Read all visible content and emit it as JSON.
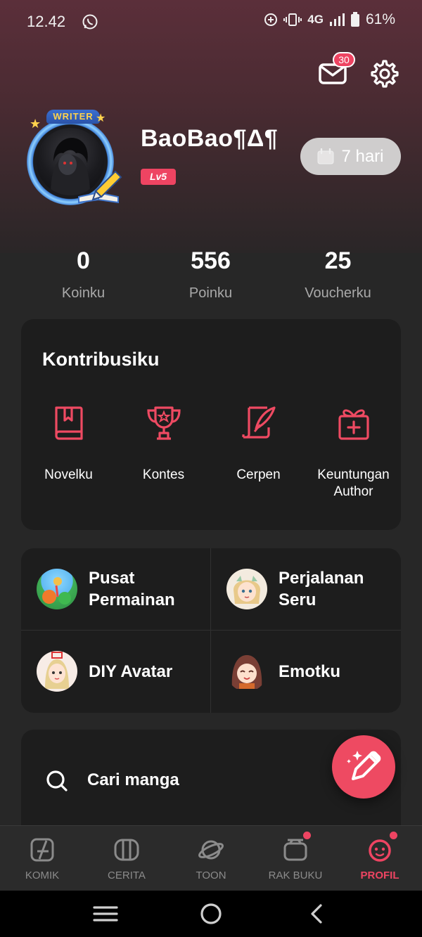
{
  "status_bar": {
    "time": "12.42",
    "network": "4G",
    "battery": "61%"
  },
  "header": {
    "mail_badge": "30"
  },
  "profile": {
    "writer_label": "WRITER",
    "username": "BaoBao¶Δ¶",
    "level": "Lv5",
    "checkin": "7 hari"
  },
  "stats": [
    {
      "value": "0",
      "label": "Koinku"
    },
    {
      "value": "556",
      "label": "Poinku"
    },
    {
      "value": "25",
      "label": "Voucherku"
    }
  ],
  "contrib": {
    "title": "Kontribusiku",
    "items": [
      {
        "label": "Novelku",
        "icon": "book-icon"
      },
      {
        "label": "Kontes",
        "icon": "trophy-icon"
      },
      {
        "label": "Cerpen",
        "icon": "quill-icon"
      },
      {
        "label": "Keuntungan Author",
        "icon": "gift-icon"
      }
    ]
  },
  "features": [
    {
      "label": "Pusat Permainan"
    },
    {
      "label": "Perjalanan Seru"
    },
    {
      "label": "DIY Avatar"
    },
    {
      "label": "Emotku"
    }
  ],
  "search": {
    "label": "Cari manga"
  },
  "bottom_nav": [
    {
      "label": "KOMIK"
    },
    {
      "label": "CERITA"
    },
    {
      "label": "TOON"
    },
    {
      "label": "RAK BUKU"
    },
    {
      "label": "PROFIL"
    }
  ],
  "colors": {
    "accent": "#ee4462",
    "card": "#1d1d1d",
    "background": "#272727"
  }
}
